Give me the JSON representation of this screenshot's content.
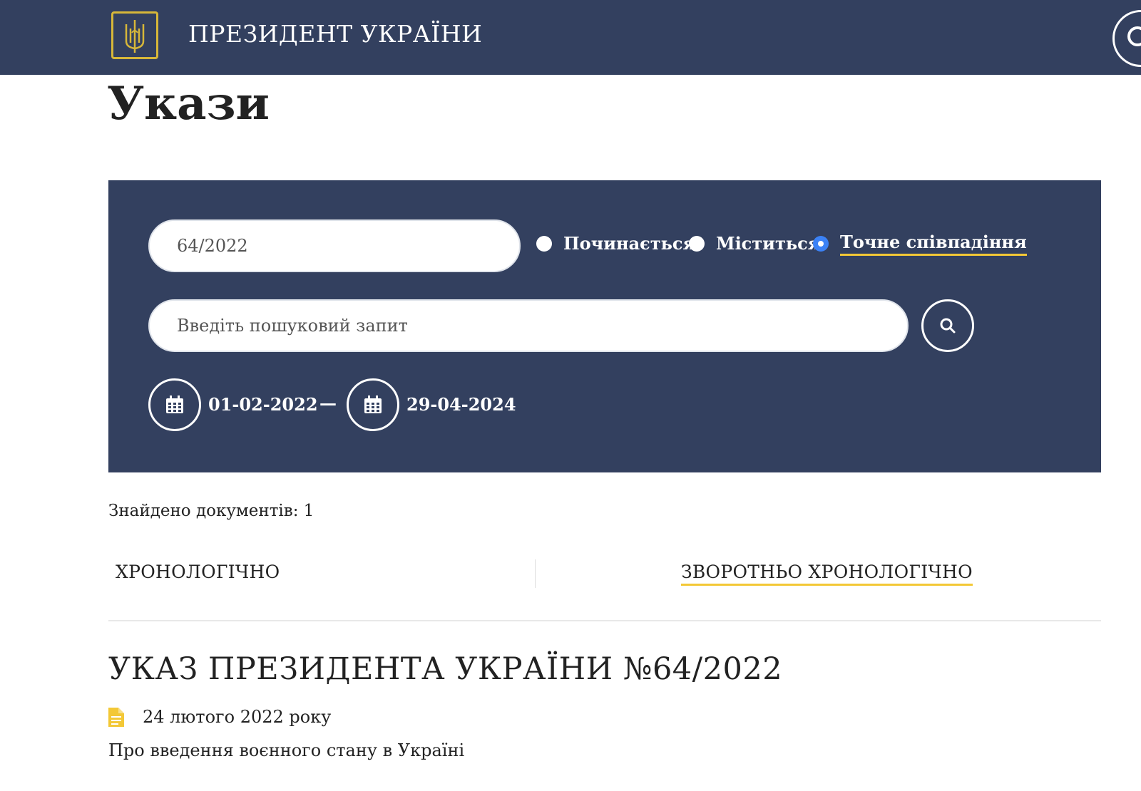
{
  "header": {
    "site_title": "ПРЕЗИДЕНТ УКРАЇНИ",
    "logo_icon": "trident-icon",
    "accent_color": "#d7b739",
    "bg_color": "#33405f"
  },
  "page": {
    "title": "Укази"
  },
  "search": {
    "number_value": "64/2022",
    "match_options": [
      {
        "label": "Починається",
        "checked": false
      },
      {
        "label": "Міститься",
        "checked": false
      },
      {
        "label": "Точне співпадіння",
        "checked": true
      }
    ],
    "query_placeholder": "Введіть пошуковий запит",
    "date_from": "01-02-2022",
    "date_separator": "—",
    "date_to": "29-04-2024",
    "search_icon": "search-icon",
    "calendar_icon": "calendar-icon"
  },
  "results": {
    "found_text": "Знайдено документів: 1",
    "sort_chrono": "ХРОНОЛОГІЧНО",
    "sort_reverse": "ЗВОРОТНЬО ХРОНОЛОГІЧНО",
    "items": [
      {
        "title": "УКАЗ ПРЕЗИДЕНТА УКРАЇНИ №64/2022",
        "date": "24 лютого 2022 року",
        "description": "Про введення воєнного стану в Україні",
        "icon": "document-icon"
      }
    ]
  }
}
